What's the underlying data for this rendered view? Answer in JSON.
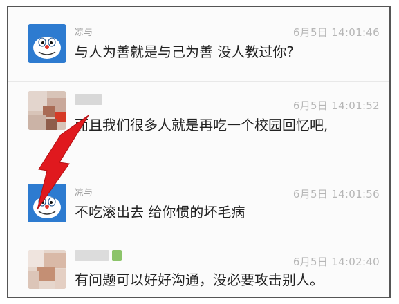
{
  "messages": [
    {
      "sender": "凉与",
      "time": "6月5日 14:01:46",
      "text": "与人为善就是与己为善 没人教过你?"
    },
    {
      "sender": "",
      "time": "6月5日 14:01:52",
      "text": "而且我们很多人就是再吃一个校园回忆吧,"
    },
    {
      "sender": "凉与",
      "time": "6月5日 14:01:56",
      "text": "不吃滚出去 给你惯的坏毛病"
    },
    {
      "sender": "",
      "time": "6月5日 14:02:40",
      "text": "有问题可以好好沟通，没必要攻击别人。"
    }
  ],
  "icons": [
    "avatar-cartoon-icon",
    "avatar-blurred-icon",
    "red-lightning-bolt-icon"
  ],
  "colors": {
    "accent_bolt": "#e0191e",
    "avatar_blue": "#2d7bd0",
    "text": "#222222",
    "meta": "#b6b6b6"
  }
}
